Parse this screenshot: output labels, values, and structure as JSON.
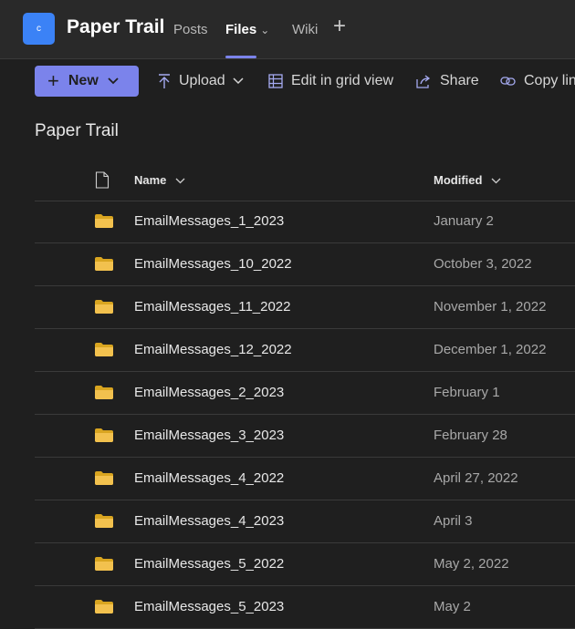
{
  "header": {
    "avatar_letter": "c",
    "team_name": "Paper Trail",
    "tabs": [
      {
        "label": "Posts"
      },
      {
        "label": "Files"
      },
      {
        "label": "Wiki"
      }
    ],
    "add_tab_icon": "plus-icon"
  },
  "toolbar": {
    "new_label": "New",
    "upload_label": "Upload",
    "grid_label": "Edit in grid view",
    "share_label": "Share",
    "copy_label": "Copy lin"
  },
  "page": {
    "title": "Paper Trail"
  },
  "table": {
    "columns": {
      "name": "Name",
      "modified": "Modified"
    },
    "rows": [
      {
        "name": "EmailMessages_1_2023",
        "modified": "January 2"
      },
      {
        "name": "EmailMessages_10_2022",
        "modified": "October 3, 2022"
      },
      {
        "name": "EmailMessages_11_2022",
        "modified": "November 1, 2022"
      },
      {
        "name": "EmailMessages_12_2022",
        "modified": "December 1, 2022"
      },
      {
        "name": "EmailMessages_2_2023",
        "modified": "February 1"
      },
      {
        "name": "EmailMessages_3_2023",
        "modified": "February 28"
      },
      {
        "name": "EmailMessages_4_2022",
        "modified": "April 27, 2022"
      },
      {
        "name": "EmailMessages_4_2023",
        "modified": "April 3"
      },
      {
        "name": "EmailMessages_5_2022",
        "modified": "May 2, 2022"
      },
      {
        "name": "EmailMessages_5_2023",
        "modified": "May 2"
      }
    ]
  },
  "colors": {
    "accent": "#7b83eb",
    "folder": "#f2c14e",
    "background": "#1f1f1f"
  }
}
